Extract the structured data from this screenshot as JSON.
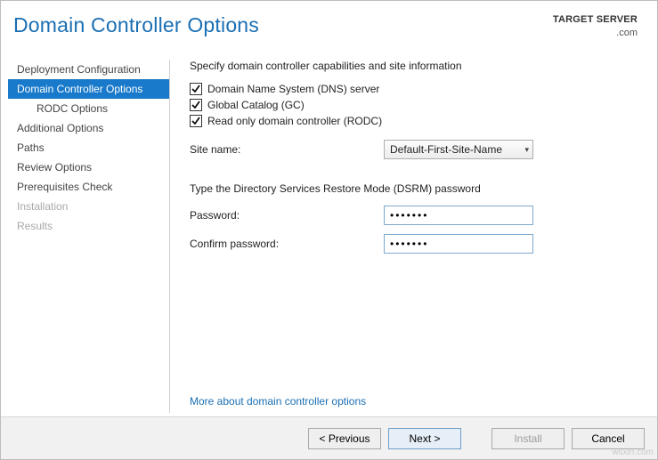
{
  "header": {
    "title": "Domain Controller Options",
    "target_label": "TARGET SERVER",
    "target_value": ".com"
  },
  "sidebar": {
    "items": [
      {
        "label": "Deployment Configuration",
        "sub": false,
        "disabled": false,
        "selected": false
      },
      {
        "label": "Domain Controller Options",
        "sub": false,
        "disabled": false,
        "selected": true
      },
      {
        "label": "RODC Options",
        "sub": true,
        "disabled": false,
        "selected": false
      },
      {
        "label": "Additional Options",
        "sub": false,
        "disabled": false,
        "selected": false
      },
      {
        "label": "Paths",
        "sub": false,
        "disabled": false,
        "selected": false
      },
      {
        "label": "Review Options",
        "sub": false,
        "disabled": false,
        "selected": false
      },
      {
        "label": "Prerequisites Check",
        "sub": false,
        "disabled": false,
        "selected": false
      },
      {
        "label": "Installation",
        "sub": false,
        "disabled": true,
        "selected": false
      },
      {
        "label": "Results",
        "sub": false,
        "disabled": true,
        "selected": false
      }
    ]
  },
  "content": {
    "caps_text": "Specify domain controller capabilities and site information",
    "checks": {
      "dns": "Domain Name System (DNS) server",
      "gc": "Global Catalog (GC)",
      "rodc": "Read only domain controller (RODC)"
    },
    "site_label": "Site name:",
    "site_value": "Default-First-Site-Name",
    "dsrm_text": "Type the Directory Services Restore Mode (DSRM) password",
    "pw_label": "Password:",
    "pw_value": "•••••••",
    "cpw_label": "Confirm password:",
    "cpw_value": "•••••••",
    "help_link": "More about domain controller options"
  },
  "footer": {
    "prev": "<  Previous",
    "next": "Next  >",
    "install": "Install",
    "cancel": "Cancel"
  },
  "watermark": "wsxin.com"
}
